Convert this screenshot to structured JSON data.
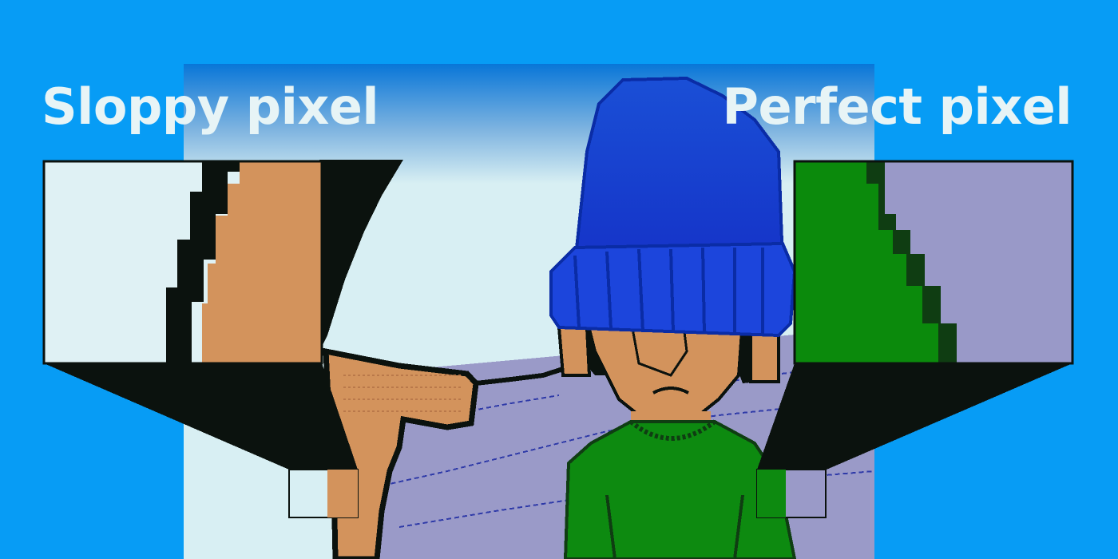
{
  "labels": {
    "left": "Sloppy pixel",
    "right": "Perfect pixel"
  },
  "colors": {
    "background": "#079cf5",
    "sky": "#d8eff3",
    "skin": "#d3935c",
    "outline": "#0b120e",
    "hat": "#1c45dc",
    "hat_dark": "#0a2ca6",
    "sweater": "#0d8a10",
    "sweater_dark": "#0f3d12",
    "floor": "#9a9ac8",
    "heading": "#e7f4f6"
  },
  "icons": [
    "pixel-art-scene",
    "magnifier-sloppy",
    "magnifier-perfect"
  ]
}
